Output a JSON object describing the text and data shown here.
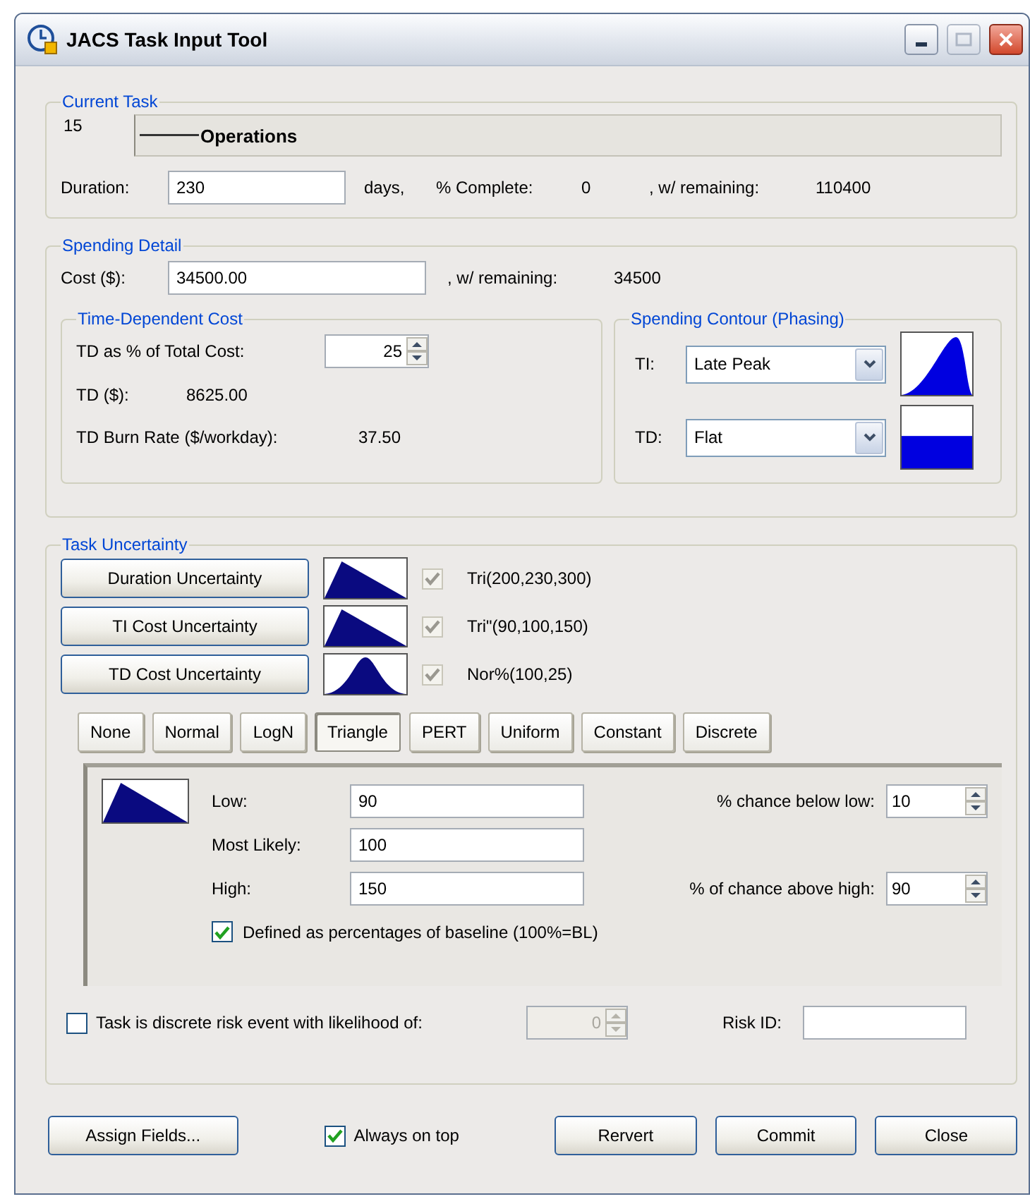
{
  "window": {
    "title": "JACS Task Input Tool"
  },
  "current_task": {
    "legend": "Current Task",
    "number": "15",
    "name": "Operations",
    "duration_label": "Duration:",
    "duration_value": "230",
    "duration_unit": "days,",
    "complete_label": "% Complete:",
    "complete_value": "0",
    "remaining_label": ", w/ remaining:",
    "remaining_value": "110400"
  },
  "spending": {
    "legend": "Spending Detail",
    "cost_label": "Cost ($):",
    "cost_value": "34500.00",
    "remaining_label": ", w/ remaining:",
    "remaining_value": "34500",
    "time_dependent": {
      "legend": "Time-Dependent Cost",
      "pct_label": "TD as % of Total Cost:",
      "pct_value": "25",
      "td_label": "TD ($):",
      "td_value": "8625.00",
      "burn_label": "TD Burn Rate ($/workday):",
      "burn_value": "37.50"
    },
    "contour": {
      "legend": "Spending Contour (Phasing)",
      "rows": [
        {
          "label": "TI:",
          "value": "Late Peak",
          "kind": "late-peak"
        },
        {
          "label": "TD:",
          "value": "Flat",
          "kind": "flat"
        }
      ]
    }
  },
  "uncertainty": {
    "legend": "Task Uncertainty",
    "rows": [
      {
        "button": "Duration Uncertainty",
        "kind": "triangle",
        "checked": true,
        "disabled": true,
        "formula": "Tri(200,230,300)"
      },
      {
        "button": "TI Cost Uncertainty",
        "kind": "triangle",
        "checked": true,
        "disabled": true,
        "formula": "Tri\"(90,100,150)"
      },
      {
        "button": "TD Cost Uncertainty",
        "kind": "normal",
        "checked": true,
        "disabled": true,
        "formula": "Nor%(100,25)"
      }
    ],
    "distributions": [
      {
        "label": "None",
        "selected": false
      },
      {
        "label": "Normal",
        "selected": false
      },
      {
        "label": "LogN",
        "selected": false
      },
      {
        "label": "Triangle",
        "selected": true
      },
      {
        "label": "PERT",
        "selected": false
      },
      {
        "label": "Uniform",
        "selected": false
      },
      {
        "label": "Constant",
        "selected": false
      },
      {
        "label": "Discrete",
        "selected": false
      }
    ],
    "params": {
      "kind": "triangle",
      "low_label": "Low:",
      "low_value": "90",
      "likely_label": "Most Likely:",
      "likely_value": "100",
      "high_label": "High:",
      "high_value": "150",
      "below_label": "% chance below low:",
      "below_value": "10",
      "above_label": "% of chance above high:",
      "above_value": "90",
      "percent_label": "Defined as percentages of baseline (100%=BL)",
      "percent_checked": true
    },
    "risk": {
      "label": "Task is discrete risk event with likelihood of:",
      "checked": false,
      "likelihood": "0",
      "likelihood_disabled": true,
      "id_label": "Risk ID:"
    }
  },
  "footer": {
    "assign": "Assign Fields...",
    "always_on_top_label": "Always on top",
    "always_on_top_checked": true,
    "buttons": [
      "Rervert",
      "Commit",
      "Close"
    ]
  }
}
